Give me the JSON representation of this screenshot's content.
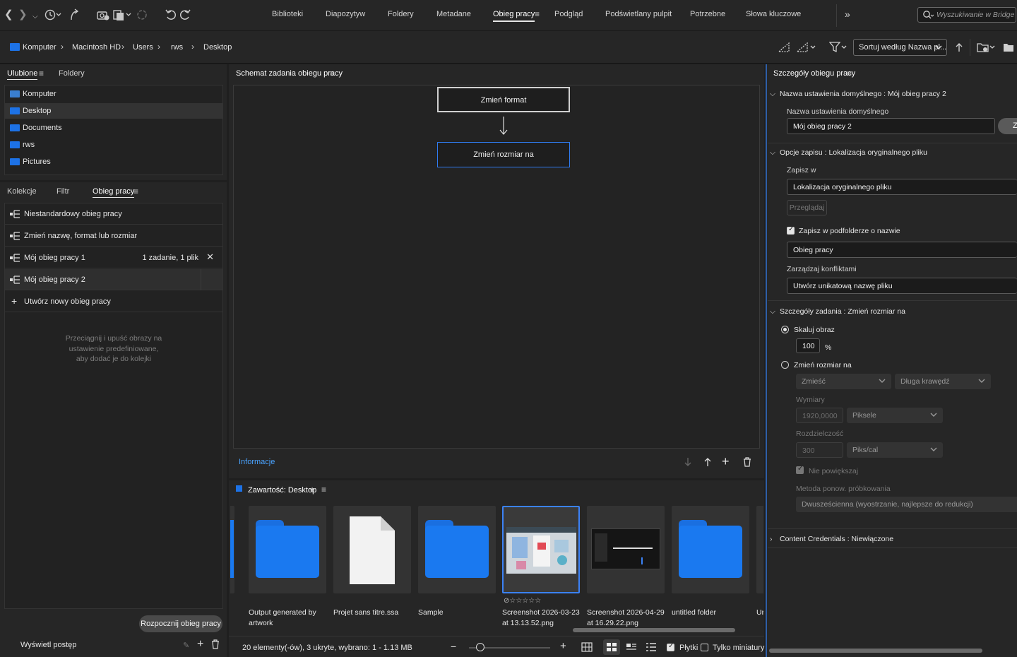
{
  "toolbar": {
    "workspaces": [
      "Biblioteki",
      "Diapozytyw",
      "Foldery",
      "Metadane",
      "Obieg pracy",
      "Podgląd",
      "Podświetlany pulpit",
      "Potrzebne",
      "Słowa kluczowe"
    ],
    "active_workspace": "Obieg pracy",
    "search_placeholder": "Wyszukiwanie w Bridge"
  },
  "path": {
    "crumbs": [
      "Komputer",
      "Macintosh HD",
      "Users",
      "rws",
      "Desktop"
    ],
    "sort_label": "Sortuj według Nazwa pl..."
  },
  "favorites": {
    "tab_favorites": "Ulubione",
    "tab_folders": "Foldery",
    "items": [
      {
        "label": "Komputer",
        "color": "#3a7fd0"
      },
      {
        "label": "Desktop",
        "color": "#1d72e6"
      },
      {
        "label": "Documents",
        "color": "#1d72e6"
      },
      {
        "label": "rws",
        "color": "#1d72e6"
      },
      {
        "label": "Pictures",
        "color": "#1d72e6"
      }
    ],
    "selected": "Desktop"
  },
  "workflow_list": {
    "tab_collections": "Kolekcje",
    "tab_filter": "Filtr",
    "tab_workflow": "Obieg pracy",
    "items": [
      {
        "label": "Niestandardowy obieg pracy",
        "meta": ""
      },
      {
        "label": "Zmień nazwę, format lub rozmiar",
        "meta": ""
      },
      {
        "label": "Mój obieg pracy 1",
        "meta": "1 zadanie, 1 plik"
      },
      {
        "label": "Mój obieg pracy 2",
        "meta": ""
      }
    ],
    "create_new": "Utwórz nowy obieg pracy",
    "drop_hint_1": "Przeciągnij i upuść obrazy na",
    "drop_hint_2": "ustawienie predefiniowane,",
    "drop_hint_3": "aby dodać je do kolejki",
    "start_button": "Rozpocznij obieg pracy",
    "show_progress": "Wyświetl postęp"
  },
  "schema": {
    "title": "Schemat zadania obiegu pracy",
    "step1": "Zmień format",
    "step2": "Zmień rozmiar na",
    "info_link": "Informacje"
  },
  "content": {
    "title": "Zawartość: Desktop",
    "items": [
      {
        "caption": "Output generated by artwork",
        "kind": "folder"
      },
      {
        "caption": "Projet sans titre.ssa",
        "kind": "file"
      },
      {
        "caption": "Sample",
        "kind": "folder"
      },
      {
        "caption": "Screenshot 2026-03-23 at 13.13.52.png",
        "kind": "image",
        "selected": true
      },
      {
        "caption": "Screenshot 2026-04-29 at 16.29.22.png",
        "kind": "image-dark"
      },
      {
        "caption": "untitled folder",
        "kind": "folder"
      }
    ],
    "trailing_caption": "Ur",
    "status": "20 elementy(-ów), 3 ukryte, wybrano: 1 - 1.13 MB",
    "zoom_fraction": 0.1,
    "tiles_label": "Płytki",
    "thumbs_only_label": "Tylko miniatury"
  },
  "details": {
    "title": "Szczegóły obiegu pracy",
    "preset_head": "Nazwa ustawienia domyślnego : Mój obieg pracy 2",
    "preset_label": "Nazwa ustawienia domyślnego",
    "preset_value": "Mój obieg pracy 2",
    "preset_btn": "Z",
    "save_head": "Opcje zapisu : Lokalizacja oryginalnego pliku",
    "save_in_label": "Zapisz w",
    "save_in_value": "Lokalizacja oryginalnego pliku",
    "browse": "Przeglądaj",
    "subfolder_label": "Zapisz w podfolderze o nazwie",
    "subfolder_value": "Obieg pracy",
    "conflicts_label": "Zarządzaj konfliktami",
    "conflicts_value": "Utwórz unikatową nazwę pliku",
    "task_head": "Szczegóły zadania : Zmień rozmiar na",
    "scale_label": "Skaluj obraz",
    "scale_value": "100",
    "scale_unit": "%",
    "resize_label": "Zmień rozmiar na",
    "fit_value": "Zmieść",
    "edge_value": "Długa krawędź",
    "dims_label": "Wymiary",
    "dims_value": "1920,0000",
    "dims_unit": "Piksele",
    "res_label": "Rozdzielczość",
    "res_value": "300",
    "res_unit": "Piks/cal",
    "no_enlarge": "Nie powiększaj",
    "resample_label": "Metoda ponow. próbkowania",
    "resample_value": "Dwusześcienna (wyostrzanie, najlepsze do redukcji)",
    "cc_head": "Content Credentials : Niewłączone"
  }
}
